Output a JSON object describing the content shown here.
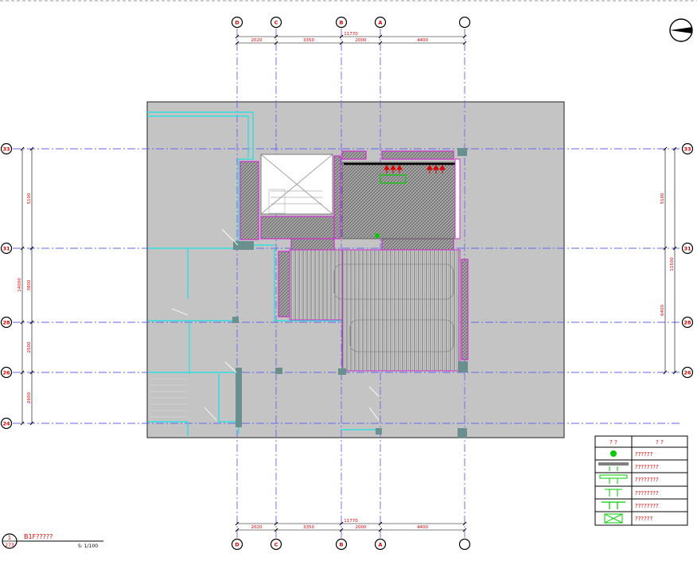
{
  "grid": {
    "columns": [
      {
        "label": "D"
      },
      {
        "label": "C"
      },
      {
        "label": "B"
      },
      {
        "label": "A"
      },
      {
        "label": ""
      }
    ],
    "rows": [
      {
        "label": "33"
      },
      {
        "label": "31"
      },
      {
        "label": "28"
      },
      {
        "label": "26"
      },
      {
        "label": "24"
      }
    ]
  },
  "dimensions": {
    "top_segments": [
      "2020",
      "3350",
      "2000",
      "4400"
    ],
    "top_total": "11770",
    "bottom_segments": [
      "2020",
      "3350",
      "2000",
      "4400"
    ],
    "bottom_total": "11770",
    "left_segments": [
      "5100",
      "3800",
      "2500",
      "2600"
    ],
    "left_total": "14000",
    "right_segments": [
      "5100",
      "6400"
    ],
    "right_total": "11500"
  },
  "legend": {
    "header": [
      "? ?",
      "?  ?"
    ],
    "rows": [
      {
        "icon": "green-circle-icon",
        "text": "??????"
      },
      {
        "icon": "grey-beam-arrows-icon",
        "text": "????????"
      },
      {
        "icon": "green-bracket-arrows-icon",
        "text": "????????"
      },
      {
        "icon": "green-arrows-short-icon",
        "text": "????????"
      },
      {
        "icon": "green-tee-arrows-icon",
        "text": "????????"
      },
      {
        "icon": "green-box-cross-icon",
        "text": "??????"
      }
    ]
  },
  "title_block": {
    "number": "1",
    "sheet": "273",
    "title": "B1F?????",
    "scale": "S: 1/100"
  },
  "colors": {
    "grid": "#6666ee",
    "slab": "#c4c4c4",
    "cyan": "#33dddd",
    "magenta": "#cc33cc",
    "red": "#dd0000",
    "green": "#00cc00"
  }
}
